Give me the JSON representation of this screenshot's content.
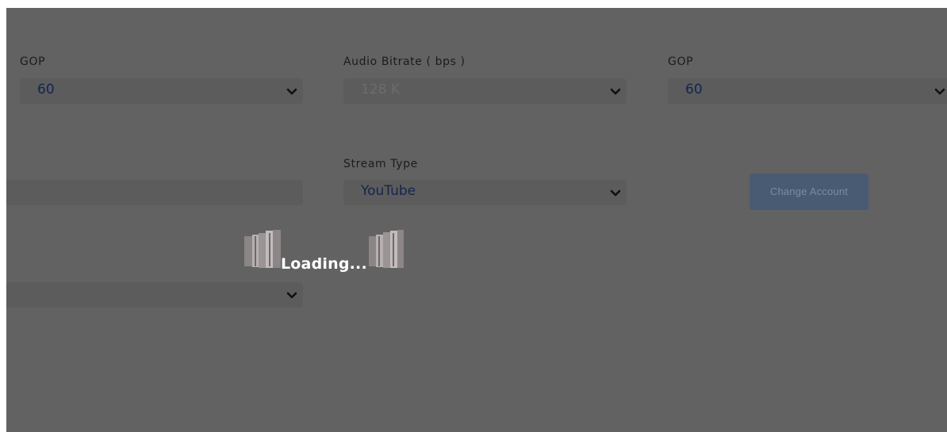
{
  "form": {
    "left_column": {
      "gop_label": "GOP",
      "gop_value": "60",
      "text_field_value": "",
      "select_value": ""
    },
    "middle_column": {
      "audio_bitrate_label": "Audio Bitrate ( bps )",
      "audio_bitrate_value": "128 K",
      "stream_type_label": "Stream Type",
      "stream_type_value": "YouTube"
    },
    "right_column": {
      "gop_label": "GOP",
      "gop_value": "60",
      "change_account_label": "Change Account"
    }
  },
  "overlay": {
    "loading_text": "Loading...",
    "background_color": "#626262",
    "button_color": "#495b72"
  },
  "icons": {
    "select_arrow": "chevron-down-icon",
    "loader": "loader-blocks-icon"
  }
}
